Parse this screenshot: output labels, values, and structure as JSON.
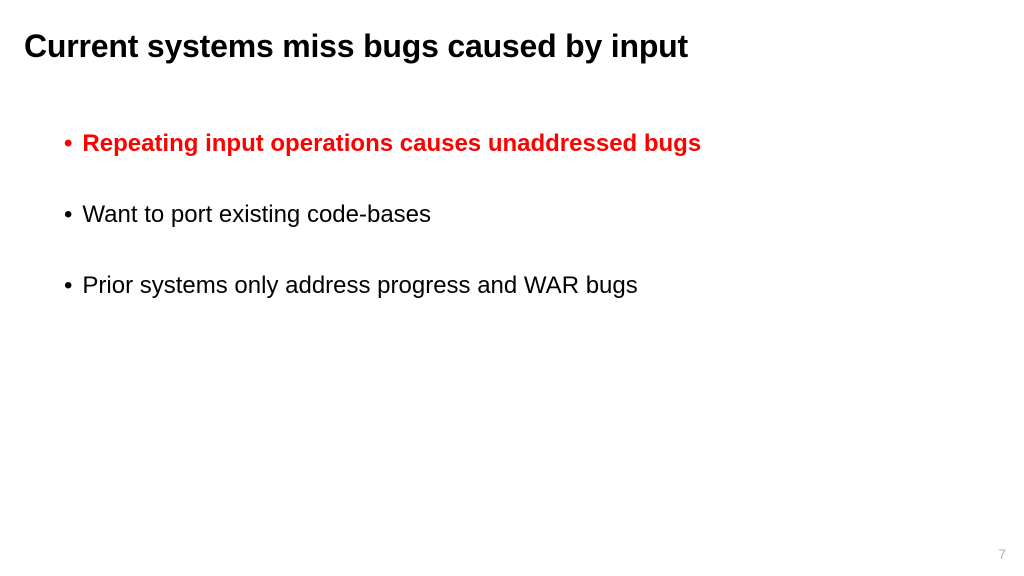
{
  "title": "Current systems miss bugs caused by input",
  "bullets": [
    {
      "text": "Repeating input operations causes unaddressed bugs",
      "highlighted": true
    },
    {
      "text": "Want to port existing code-bases",
      "highlighted": false
    },
    {
      "text": "Prior systems only address progress and WAR bugs",
      "highlighted": false
    }
  ],
  "page_number": "7",
  "colors": {
    "highlight": "#ff0000",
    "text": "#000000",
    "page_number": "#b0b0b0"
  }
}
